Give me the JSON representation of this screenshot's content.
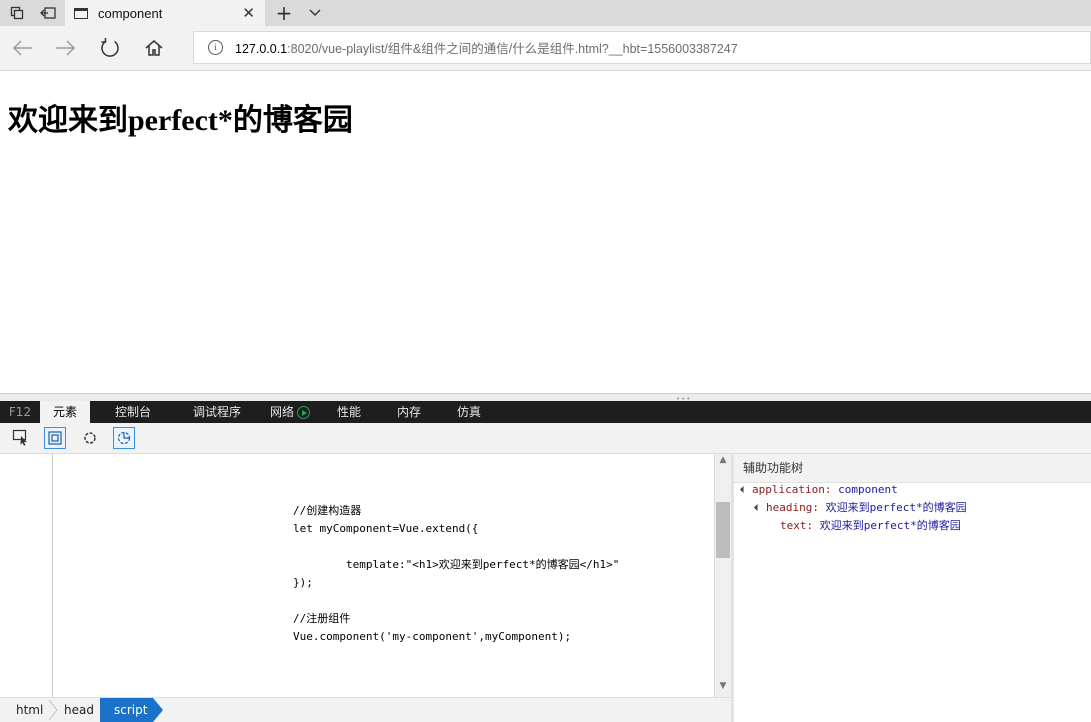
{
  "browser": {
    "tab": {
      "title": "component",
      "close": "✕"
    },
    "new_tab": "+",
    "address": {
      "host": "127.0.0.1",
      "rest": ":8020/vue-playlist/组件&组件之间的通信/什么是组件.html?__hbt=1556003387247"
    }
  },
  "page": {
    "heading": "欢迎来到perfect*的博客园"
  },
  "devtools": {
    "tabs": [
      {
        "label": "F12"
      },
      {
        "label": "元素"
      },
      {
        "label": "控制台"
      },
      {
        "label": "调试程序"
      },
      {
        "label": "网络"
      },
      {
        "label": "性能"
      },
      {
        "label": "内存"
      },
      {
        "label": "仿真"
      }
    ],
    "source_lines": [
      "//创建构造器",
      "let myComponent=Vue.extend({",
      "",
      "        template:\"<h1>欢迎来到perfect*的博客园</h1>\"",
      "});",
      "",
      "//注册组件",
      "Vue.component('my-component',myComponent);"
    ],
    "accessibility": {
      "title": "辅助功能树",
      "application_key": "application:",
      "application_value": "component",
      "heading_key": "heading:",
      "heading_value": "欢迎来到perfect*的博客园",
      "text_key": "text:",
      "text_value": "欢迎来到perfect*的博客园"
    },
    "breadcrumbs": [
      "html",
      "head",
      "script"
    ]
  },
  "colors": {
    "accent": "#1a73c9",
    "devtools_tabbar": "#1e1e1e",
    "network_record": "#22a65a"
  }
}
